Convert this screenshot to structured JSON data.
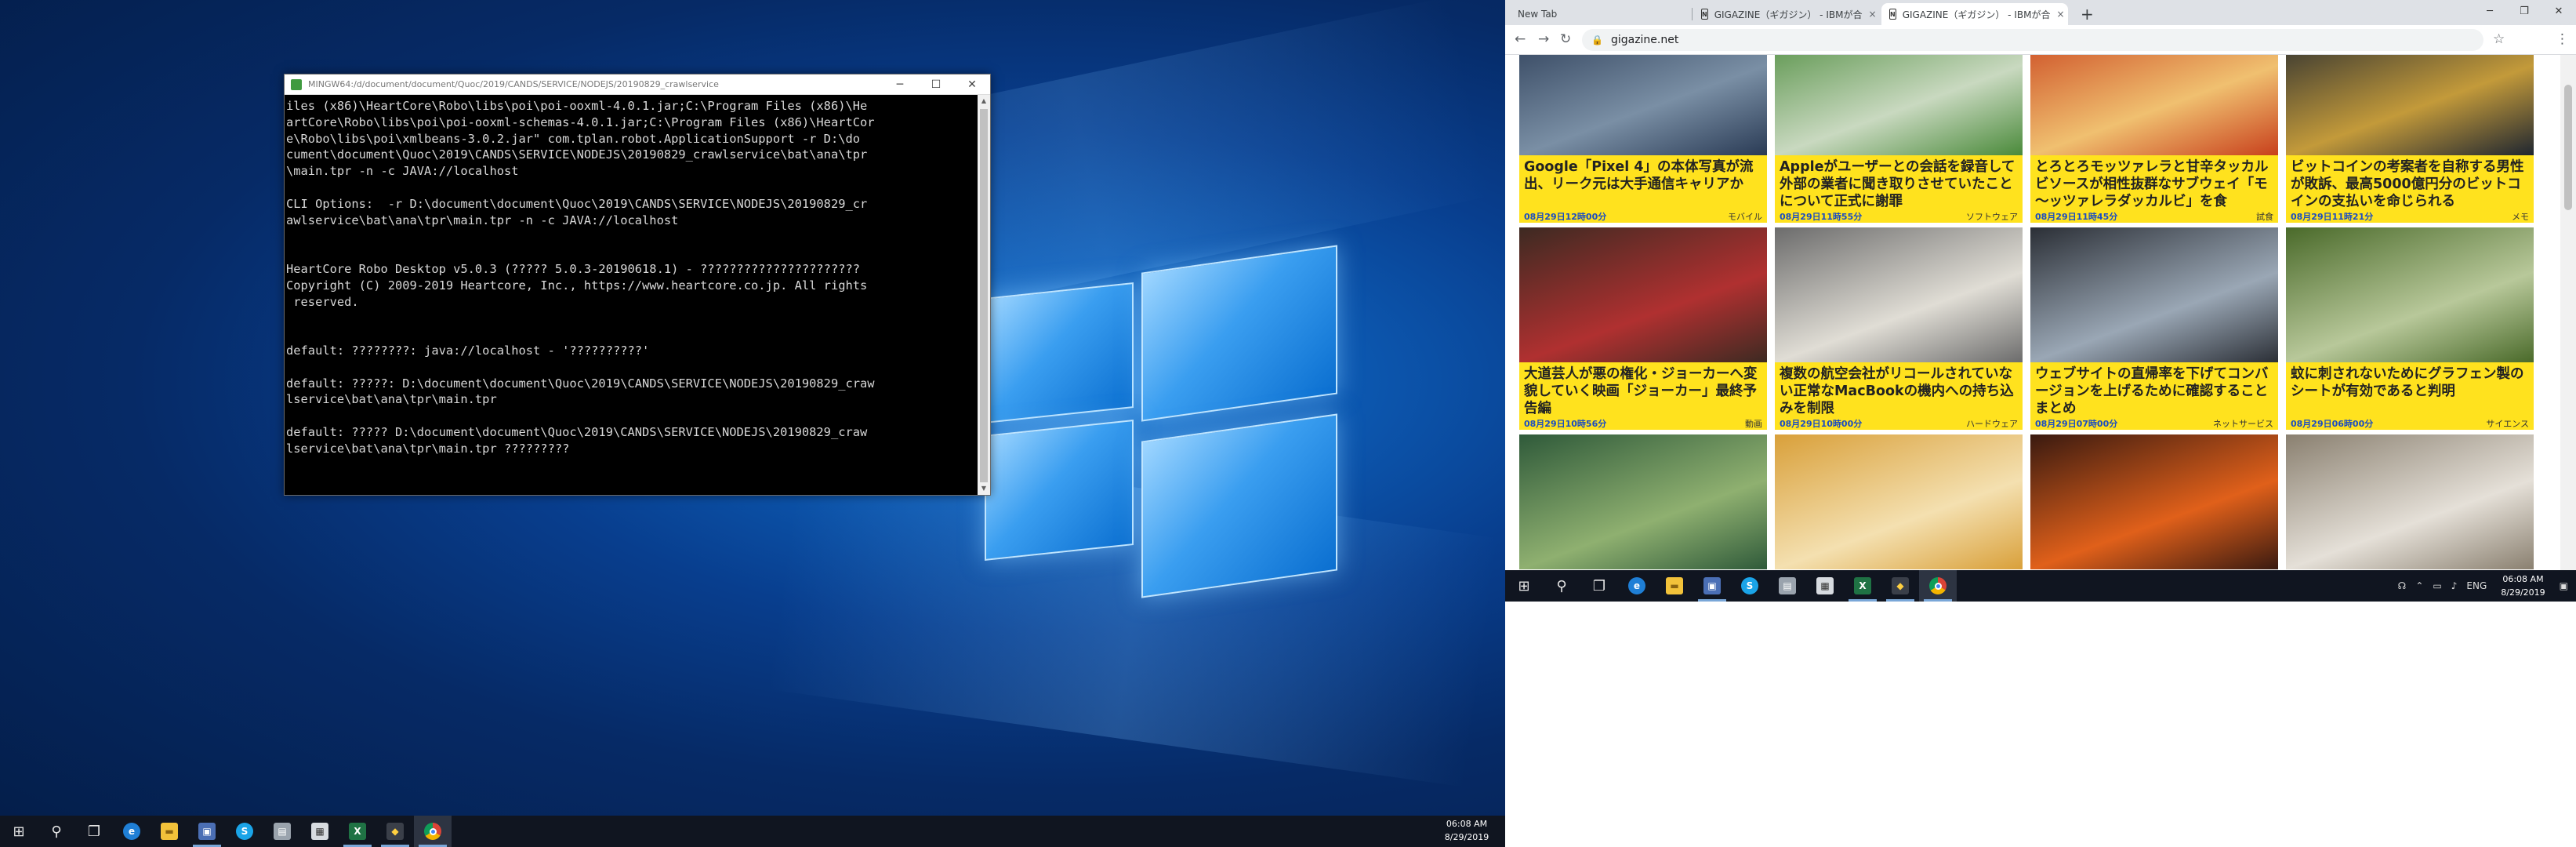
{
  "terminal": {
    "title": "MINGW64:/d/document/document/Quoc/2019/CANDS/SERVICE/NODEJS/20190829_crawlservice",
    "lines": [
      "iles (x86)\\HeartCore\\Robo\\libs\\poi\\poi-ooxml-4.0.1.jar;C:\\Program Files (x86)\\He",
      "artCore\\Robo\\libs\\poi\\poi-ooxml-schemas-4.0.1.jar;C:\\Program Files (x86)\\HeartCor",
      "e\\Robo\\libs\\poi\\xmlbeans-3.0.2.jar\" com.tplan.robot.ApplicationSupport -r D:\\do",
      "cument\\document\\Quoc\\2019\\CANDS\\SERVICE\\NODEJS\\20190829_crawlservice\\bat\\ana\\tpr",
      "\\main.tpr -n -c JAVA://localhost",
      "",
      "CLI Options:  -r D:\\document\\document\\Quoc\\2019\\CANDS\\SERVICE\\NODEJS\\20190829_cr",
      "awlservice\\bat\\ana\\tpr\\main.tpr -n -c JAVA://localhost",
      "",
      "",
      "HeartCore Robo Desktop v5.0.3 (????? 5.0.3-20190618.1) - ??????????????????????",
      "Copyright (C) 2009-2019 Heartcore, Inc., https://www.heartcore.co.jp. All rights",
      " reserved.",
      "",
      "",
      "default: ????????: java://localhost - '??????????'",
      "",
      "default: ?????: D:\\document\\document\\Quoc\\2019\\CANDS\\SERVICE\\NODEJS\\20190829_craw",
      "lservice\\bat\\ana\\tpr\\main.tpr",
      "",
      "default: ????? D:\\document\\document\\Quoc\\2019\\CANDS\\SERVICE\\NODEJS\\20190829_craw",
      "lservice\\bat\\ana\\tpr\\main.tpr ?????????"
    ],
    "btn_min": "─",
    "btn_max": "☐",
    "btn_close": "✕"
  },
  "taskbar_left": {
    "time": "06:08 AM",
    "date": "8/29/2019"
  },
  "browser": {
    "tabs": [
      {
        "label": "New Tab"
      },
      {
        "label": "GIGAZINE（ギガジン） - IBMが合"
      },
      {
        "label": "GIGAZINE（ギガジン） - IBMが合"
      }
    ],
    "url": "gigazine.net",
    "favicon_letter": "N",
    "new_tab_symbol": "+",
    "tab_close_symbol": "×",
    "win_min": "─",
    "win_max": "❐",
    "win_close": "✕"
  },
  "articles": [
    {
      "title": "Google「Pixel 4」の本体写真が流出、リーク元は大手通信キャリアか",
      "date": "08月29日12時00分",
      "cat": "モバイル",
      "colors": [
        "#2a3b55",
        "#7a8fa5"
      ]
    },
    {
      "title": "Appleがユーザーとの会話を録音して外部の業者に聞き取りさせていたことについて正式に謝罪",
      "date": "08月29日11時55分",
      "cat": "ソフトウェア",
      "colors": [
        "#4a8a3a",
        "#c9d9c0"
      ]
    },
    {
      "title": "とろとろモッツァレラと甘辛タッカルビソースが相性抜群なサブウェイ「モ～ッツァレラダッカルビ」を食",
      "date": "08月29日11時45分",
      "cat": "試食",
      "colors": [
        "#c8401c",
        "#f0c070"
      ]
    },
    {
      "title": "ビットコインの考案者を自称する男性が敗訴、最高5000億円分のビットコインの支払いを命じられる",
      "date": "08月29日11時21分",
      "cat": "メモ",
      "colors": [
        "#1f2630",
        "#c39a3a"
      ]
    },
    {
      "title": "大道芸人が悪の権化・ジョーカーへ変貌していく映画「ジョーカー」最終予告編",
      "date": "08月29日10時56分",
      "cat": "動画",
      "colors": [
        "#3d2a22",
        "#b03030"
      ]
    },
    {
      "title": "複数の航空会社がリコールされていない正常なMacBookの機内への持ち込みを制限",
      "date": "08月29日10時00分",
      "cat": "ハードウェア",
      "colors": [
        "#6c6c6c",
        "#e0ddd5"
      ]
    },
    {
      "title": "ウェブサイトの直帰率を下げてコンバージョンを上げるために確認することまとめ",
      "date": "08月29日07時00分",
      "cat": "ネットサービス",
      "colors": [
        "#2b2f36",
        "#9aa7b5"
      ]
    },
    {
      "title": "蚊に刺されないためにグラフェン製のシートが有効であると判明",
      "date": "08月29日06時00分",
      "cat": "サイエンス",
      "colors": [
        "#4a6a2a",
        "#b8c89a"
      ]
    },
    {
      "title": "",
      "date": "",
      "cat": "",
      "colors": [
        "#2f5a3a",
        "#8fb070"
      ]
    },
    {
      "title": "",
      "date": "",
      "cat": "",
      "colors": [
        "#d9a03a",
        "#f4e0b0"
      ]
    },
    {
      "title": "",
      "date": "",
      "cat": "",
      "colors": [
        "#3a1a10",
        "#e0601a"
      ]
    },
    {
      "title": "",
      "date": "",
      "cat": "",
      "colors": [
        "#8a8070",
        "#e5e0d8"
      ]
    }
  ],
  "taskbar_right": {
    "time": "06:08 AM",
    "date": "8/29/2019",
    "lang": "ENG"
  },
  "colors": {
    "accent_yellow": "#ffe21e",
    "link_blue": "#1a4cc2",
    "taskbar": "#101520"
  }
}
